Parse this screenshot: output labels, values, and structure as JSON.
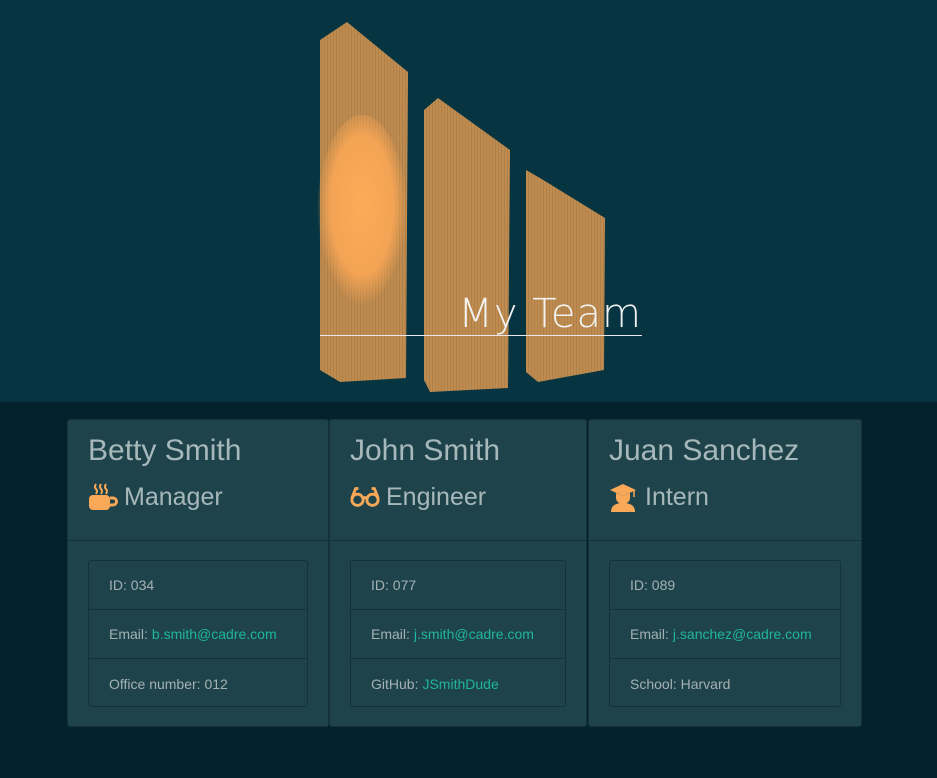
{
  "header": {
    "title": "My Team",
    "logo_icon": "paint-brush-bars-logo",
    "accent_color": "#f9a858"
  },
  "colors": {
    "link": "#1fb5a0",
    "card_bg": "#1f434b",
    "hero_bg": "#073441",
    "page_bg": "#04222e"
  },
  "team": [
    {
      "name": "Betty Smith",
      "role": "Manager",
      "role_icon": "coffee-mug-icon",
      "id_label": "ID:",
      "id": "034",
      "email_label": "Email:",
      "email": "b.smith@cadre.com",
      "extra_label": "Office number:",
      "extra_value": "012"
    },
    {
      "name": "John Smith",
      "role": "Engineer",
      "role_icon": "glasses-icon",
      "id_label": "ID:",
      "id": "077",
      "email_label": "Email:",
      "email": "j.smith@cadre.com",
      "extra_label": "GitHub:",
      "extra_value": "JSmithDude"
    },
    {
      "name": "Juan Sanchez",
      "role": "Intern",
      "role_icon": "graduate-icon",
      "id_label": "ID:",
      "id": "089",
      "email_label": "Email:",
      "email": "j.sanchez@cadre.com",
      "extra_label": "School:",
      "extra_value": "Harvard"
    }
  ]
}
